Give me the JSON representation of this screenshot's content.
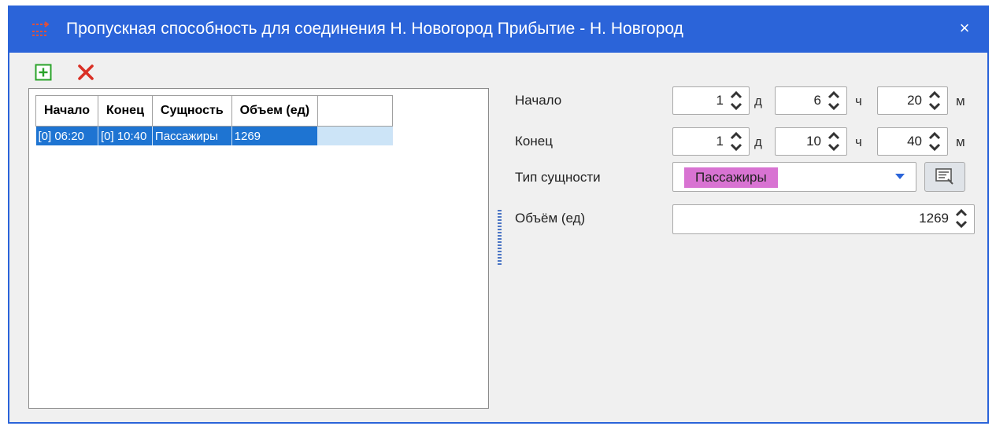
{
  "window": {
    "title": "Пропускная способность для соединения Н. Новогород Прибытие - Н. Новгород",
    "close_symbol": "×"
  },
  "toolbar": {
    "add_icon": "add-icon",
    "delete_icon": "delete-icon",
    "add_color": "#2aa32a",
    "delete_color": "#d93025"
  },
  "table": {
    "columns": [
      "Начало",
      "Конец",
      "Сущность",
      "Объем (ед)"
    ],
    "rows": [
      [
        "[0] 06:20",
        "[0] 10:40",
        "Пассажиры",
        "1269"
      ]
    ]
  },
  "form": {
    "start": {
      "label": "Начало",
      "days": "1",
      "days_unit": "д",
      "hours": "6",
      "hours_unit": "ч",
      "minutes": "20",
      "minutes_unit": "м"
    },
    "end": {
      "label": "Конец",
      "days": "1",
      "days_unit": "д",
      "hours": "10",
      "hours_unit": "ч",
      "minutes": "40",
      "minutes_unit": "м"
    },
    "entity_type": {
      "label": "Тип сущности",
      "value": "Пассажиры",
      "chip_color": "#d873d2"
    },
    "volume": {
      "label": "Объём (ед)",
      "value": "1269"
    }
  },
  "colors": {
    "titlebar": "#2b64d9",
    "selection": "#1e74d2",
    "selection_light": "#cce4f7"
  }
}
